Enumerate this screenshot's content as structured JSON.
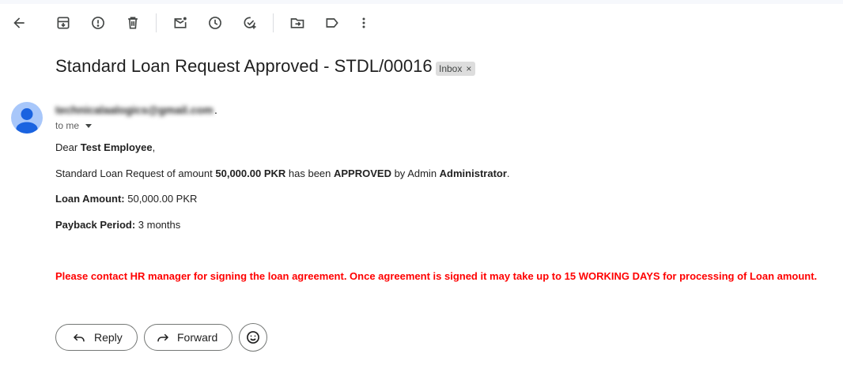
{
  "toolbar": {
    "icons": [
      "back-icon",
      "archive-icon",
      "report-spam-icon",
      "delete-icon",
      "mark-unread-icon",
      "snooze-icon",
      "add-to-tasks-icon",
      "move-to-icon",
      "label-icon",
      "more-options-icon"
    ]
  },
  "email": {
    "subject": "Standard Loan Request Approved - STDL/00016",
    "label": "Inbox",
    "label_remove": "×",
    "sender": "technicalaalogics@gmail.com",
    "sender_trailing": ".",
    "recipient": "to me"
  },
  "body": {
    "greeting_prefix": "Dear ",
    "employee_name": "Test Employee",
    "greeting_suffix": ",",
    "request_prefix": "Standard Loan Request of amount ",
    "request_amount": "50,000.00 PKR",
    "request_mid": " has been ",
    "request_status": "APPROVED",
    "request_by": " by Admin ",
    "approver": "Administrator",
    "request_end": ".",
    "loan_amount_label": "Loan Amount:",
    "loan_amount_value": " 50,000.00 PKR",
    "payback_label": "Payback Period:",
    "payback_value": " 3 months",
    "notice": "Please contact HR manager for signing the loan agreement. Once agreement is signed it may take up to 15 WORKING DAYS for processing of Loan amount."
  },
  "actions": {
    "reply": "Reply",
    "forward": "Forward",
    "emoji_icon": "add-reaction-icon"
  },
  "colors": {
    "notice": "#ff0000",
    "avatar_bg": "#a8c7fa",
    "avatar_fg": "#1a63e0",
    "label_bg": "#dddddd"
  }
}
